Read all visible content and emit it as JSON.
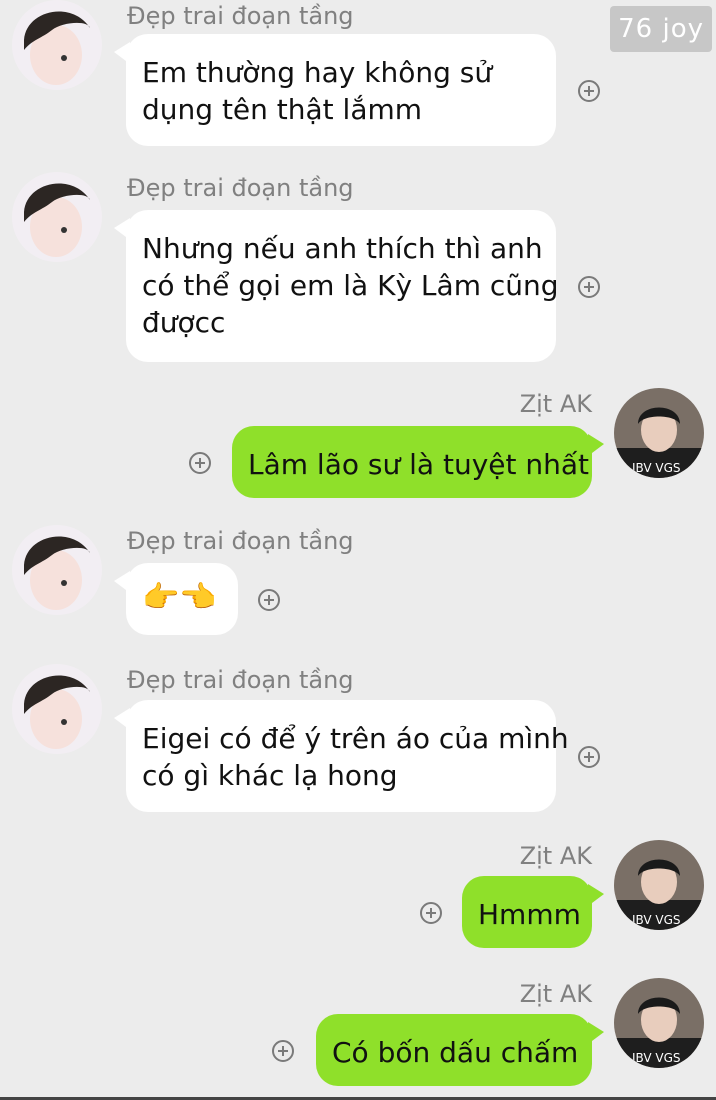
{
  "watermark": "76 joy",
  "contacts": {
    "left_name": "Đẹp trai đoạn tầng",
    "right_name": "Zịt AK"
  },
  "messages": [
    {
      "side": "left",
      "sender": "Đẹp trai đoạn tầng",
      "lines": [
        "Em thường hay không sử",
        "dụng tên thật lắmm"
      ]
    },
    {
      "side": "left",
      "sender": "Đẹp trai đoạn tầng",
      "lines": [
        "Nhưng nếu anh thích thì anh",
        "có thể gọi em là Kỳ Lâm cũng",
        "đượcc"
      ]
    },
    {
      "side": "right",
      "sender": "Zịt AK",
      "lines": [
        "Lâm lão sư là tuyệt nhất"
      ]
    },
    {
      "side": "left",
      "sender": "Đẹp trai đoạn tầng",
      "lines": [
        "👉👈"
      ]
    },
    {
      "side": "left",
      "sender": "Đẹp trai đoạn tầng",
      "lines": [
        "Eigei có để ý trên áo của mình",
        "có gì khác lạ hong"
      ]
    },
    {
      "side": "right",
      "sender": "Zịt AK",
      "lines": [
        "Hmmm"
      ]
    },
    {
      "side": "right",
      "sender": "Zịt AK",
      "lines": [
        "Có bốn dấu chấm"
      ]
    }
  ],
  "colors": {
    "background": "#ececec",
    "left_bubble": "#ffffff",
    "right_bubble": "#8fe02a",
    "sender_text": "#808080"
  },
  "icons": {
    "add": "plus-circle-icon",
    "left_avatar": "avatar-photo",
    "right_avatar": "avatar-photo"
  }
}
